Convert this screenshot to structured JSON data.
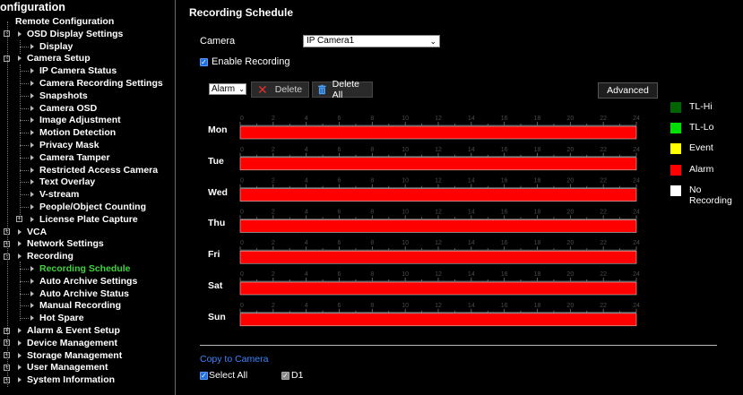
{
  "sidebar": {
    "title": "onfiguration",
    "items": [
      {
        "label": "Remote Configuration",
        "level": 0,
        "expander": "",
        "active": false
      },
      {
        "label": "OSD Display Settings",
        "level": 1,
        "expander": "-",
        "active": false
      },
      {
        "label": "Display",
        "level": 2,
        "expander": "",
        "active": false
      },
      {
        "label": "Camera Setup",
        "level": 1,
        "expander": "-",
        "active": false
      },
      {
        "label": "IP Camera Status",
        "level": 2,
        "expander": "",
        "active": false
      },
      {
        "label": "Camera Recording Settings",
        "level": 2,
        "expander": "",
        "active": false
      },
      {
        "label": "Snapshots",
        "level": 2,
        "expander": "",
        "active": false
      },
      {
        "label": "Camera OSD",
        "level": 2,
        "expander": "",
        "active": false
      },
      {
        "label": "Image Adjustment",
        "level": 2,
        "expander": "",
        "active": false
      },
      {
        "label": "Motion Detection",
        "level": 2,
        "expander": "",
        "active": false
      },
      {
        "label": "Privacy Mask",
        "level": 2,
        "expander": "",
        "active": false
      },
      {
        "label": "Camera Tamper",
        "level": 2,
        "expander": "",
        "active": false
      },
      {
        "label": "Restricted Access Camera",
        "level": 2,
        "expander": "",
        "active": false
      },
      {
        "label": "Text Overlay",
        "level": 2,
        "expander": "",
        "active": false
      },
      {
        "label": "V-stream",
        "level": 2,
        "expander": "",
        "active": false
      },
      {
        "label": "People/Object Counting",
        "level": 2,
        "expander": "",
        "active": false
      },
      {
        "label": "License Plate Capture",
        "level": 2,
        "expander": "+",
        "active": false
      },
      {
        "label": "VCA",
        "level": 1,
        "expander": "+",
        "active": false
      },
      {
        "label": "Network Settings",
        "level": 1,
        "expander": "+",
        "active": false
      },
      {
        "label": "Recording",
        "level": 1,
        "expander": "-",
        "active": false
      },
      {
        "label": "Recording Schedule",
        "level": 2,
        "expander": "",
        "active": true
      },
      {
        "label": "Auto Archive Settings",
        "level": 2,
        "expander": "",
        "active": false
      },
      {
        "label": "Auto Archive Status",
        "level": 2,
        "expander": "",
        "active": false
      },
      {
        "label": "Manual Recording",
        "level": 2,
        "expander": "",
        "active": false
      },
      {
        "label": "Hot Spare",
        "level": 2,
        "expander": "",
        "active": false
      },
      {
        "label": "Alarm & Event Setup",
        "level": 1,
        "expander": "+",
        "active": false
      },
      {
        "label": "Device Management",
        "level": 1,
        "expander": "+",
        "active": false
      },
      {
        "label": "Storage Management",
        "level": 1,
        "expander": "+",
        "active": false
      },
      {
        "label": "User Management",
        "level": 1,
        "expander": "+",
        "active": false
      },
      {
        "label": "System Information",
        "level": 1,
        "expander": "+",
        "active": false
      }
    ]
  },
  "main": {
    "title": "Recording Schedule",
    "camera_label": "Camera",
    "camera_value": "IP Camera1",
    "enable_recording_label": "Enable Recording",
    "enable_recording_checked": true,
    "mode_value": "Alarm",
    "delete_label": "Delete",
    "delete_all_label": "Delete All",
    "advanced_label": "Advanced",
    "copy_to_camera_label": "Copy to Camera",
    "select_all_label": "Select All",
    "d1_label": "D1"
  },
  "schedule": {
    "hour_labels": [
      "0",
      "2",
      "4",
      "6",
      "8",
      "10",
      "12",
      "14",
      "16",
      "18",
      "20",
      "22",
      "24"
    ],
    "days": [
      {
        "name": "Mon",
        "type": "Alarm",
        "start": 0,
        "end": 24
      },
      {
        "name": "Tue",
        "type": "Alarm",
        "start": 0,
        "end": 24
      },
      {
        "name": "Wed",
        "type": "Alarm",
        "start": 0,
        "end": 24
      },
      {
        "name": "Thu",
        "type": "Alarm",
        "start": 0,
        "end": 24
      },
      {
        "name": "Fri",
        "type": "Alarm",
        "start": 0,
        "end": 24
      },
      {
        "name": "Sat",
        "type": "Alarm",
        "start": 0,
        "end": 24
      },
      {
        "name": "Sun",
        "type": "Alarm",
        "start": 0,
        "end": 24
      }
    ]
  },
  "legend": [
    {
      "label": "TL-Hi",
      "color": "#006400"
    },
    {
      "label": "TL-Lo",
      "color": "#00e000"
    },
    {
      "label": "Event",
      "color": "#ffff00"
    },
    {
      "label": "Alarm",
      "color": "#ff0000"
    },
    {
      "label": "No Recording",
      "color": "#ffffff"
    }
  ],
  "colors": {
    "active_nav": "#3fd43f",
    "link": "#3a86ff",
    "alarm": "#ff0000"
  }
}
